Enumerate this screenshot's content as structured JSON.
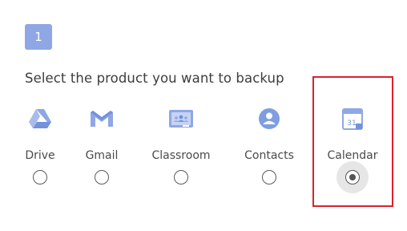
{
  "step": {
    "number": "1"
  },
  "heading": "Select the product you want to backup",
  "products": [
    {
      "label": "Drive",
      "icon": "google-drive-icon",
      "selected": false
    },
    {
      "label": "Gmail",
      "icon": "gmail-icon",
      "selected": false
    },
    {
      "label": "Classroom",
      "icon": "google-classroom-icon",
      "selected": false
    },
    {
      "label": "Contacts",
      "icon": "google-contacts-icon",
      "selected": false
    },
    {
      "label": "Calendar",
      "icon": "google-calendar-icon",
      "selected": true
    }
  ],
  "calendar_icon_text": "31",
  "colors": {
    "accent": "#8fa7e4",
    "highlight": "#d9232a",
    "icon_blue": "#7f9de0"
  }
}
